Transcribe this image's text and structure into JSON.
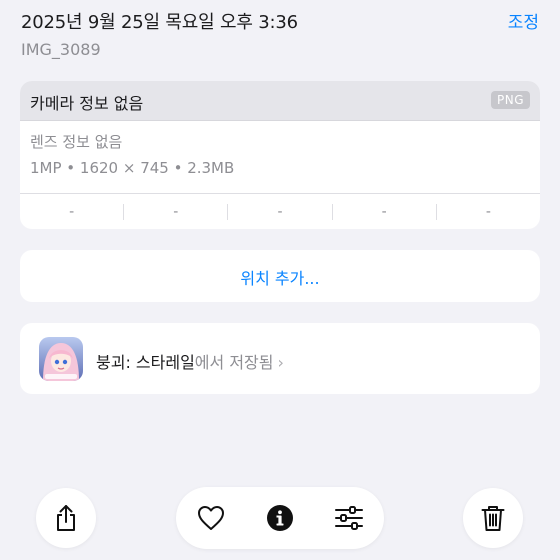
{
  "header": {
    "date_time": "2025년 9월 25일 목요일 오후 3:36",
    "adjust_label": "조정",
    "filename": "IMG_3089"
  },
  "camera_info": {
    "title": "카메라 정보 없음",
    "format_badge": "PNG",
    "lens": "렌즈 정보 없음",
    "specs": "1MP • 1620 × 745 • 2.3MB",
    "exif": [
      "-",
      "-",
      "-",
      "-",
      "-"
    ]
  },
  "location": {
    "add_label": "위치 추가..."
  },
  "source": {
    "app_name": "붕괴: 스타레일",
    "suffix": "에서 저장됨",
    "chevron": "›"
  },
  "toolbar": {
    "icons": [
      "share-icon",
      "heart-icon",
      "info-icon",
      "adjust-sliders-icon",
      "trash-icon"
    ]
  },
  "colors": {
    "accent": "#0a84ff",
    "background": "#f2f2f7",
    "secondary_text": "#8e8e93"
  }
}
